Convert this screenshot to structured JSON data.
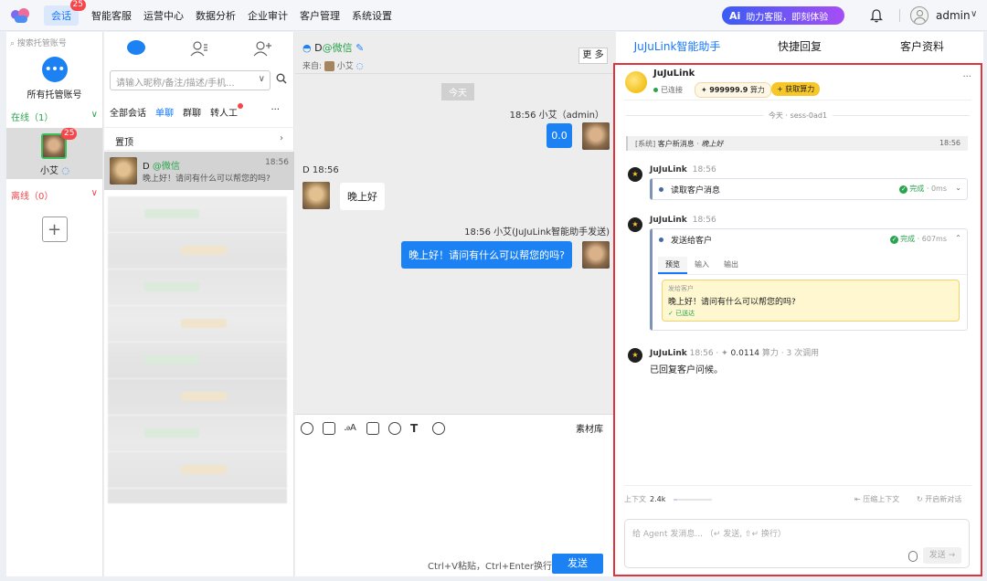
{
  "topbar": {
    "nav": [
      {
        "label": "会话",
        "badge": "25",
        "active": true
      },
      {
        "label": "智能客服"
      },
      {
        "label": "运营中心"
      },
      {
        "label": "数据分析"
      },
      {
        "label": "企业审计"
      },
      {
        "label": "客户管理"
      },
      {
        "label": "系统设置"
      }
    ],
    "ai_promo": {
      "icon": "Ai",
      "text": "助力客服，即刻体验"
    },
    "user": "admin"
  },
  "accounts": {
    "search_placeholder": "搜索托管账号",
    "all_label": "所有托管账号",
    "online_label": "在线（1）",
    "offline_label": "离线（0）",
    "account": {
      "name": "小艾",
      "badge": "25"
    }
  },
  "conversations": {
    "search_placeholder": "请输入昵称/备注/描述/手机...",
    "filters": [
      "全部会话",
      "单聊",
      "群聊",
      "转人工"
    ],
    "pinned_label": "置顶",
    "item": {
      "name": "D",
      "source": "@微信",
      "time": "18:56",
      "preview": "晚上好！请问有什么可以帮您的吗?"
    }
  },
  "chat": {
    "name": "D",
    "source": "@微信",
    "from_label": "来自:",
    "from_name": "小艾",
    "more_label": "更 多",
    "today_label": "今天",
    "messages": [
      {
        "meta": "18:56  小艾（admin）",
        "text": "0.0"
      },
      {
        "meta": "D  18:56",
        "text": "晚上好"
      },
      {
        "meta": "18:56  小艾(JuJuLink智能助手发送)",
        "text": "晚上好！请问有什么可以帮您的吗?"
      }
    ],
    "library_label": "素材库",
    "hint": "Ctrl+V粘贴，Ctrl+Enter换行",
    "send_label": "发送"
  },
  "assistant": {
    "tabs": [
      "JuJuLink智能助手",
      "快捷回复",
      "客户资料"
    ],
    "agent_name": "JuJuLink",
    "status": "已连接",
    "credit": "999999.9",
    "credit_unit": "算力",
    "get_credit": "+ 获取算力",
    "session": "今天 · sess-0ad1",
    "system_prefix": "[系统]",
    "system_label": "客户新消息",
    "system_text": "晚上好",
    "system_time": "18:56",
    "steps": [
      {
        "name": "JuJuLink",
        "time": "18:56",
        "title": "读取客户消息",
        "status": "完成",
        "duration": "0ms"
      },
      {
        "name": "JuJuLink",
        "time": "18:56",
        "title": "发送给客户",
        "status": "完成",
        "duration": "607ms",
        "subtabs": [
          "预览",
          "输入",
          "输出"
        ],
        "preview_head": "发给客户",
        "preview_text": "晚上好！请问有什么可以帮您的吗?",
        "preview_foot": "✓ 已送达"
      }
    ],
    "final": {
      "name": "JuJuLink",
      "time": "18:56",
      "cost": "0.0114",
      "cost_unit": "算力",
      "calls": "3 次调用",
      "text": "已回复客户问候。"
    },
    "context_label": "上下文",
    "context_value": "2.4k",
    "context_fill": 0.1,
    "compress_label": "压缩上下文",
    "new_label": "开启新对话",
    "input_placeholder": "给 Agent 发消息...  （↵ 发送, ⇧↵ 换行）",
    "send_label": "发送 →"
  }
}
